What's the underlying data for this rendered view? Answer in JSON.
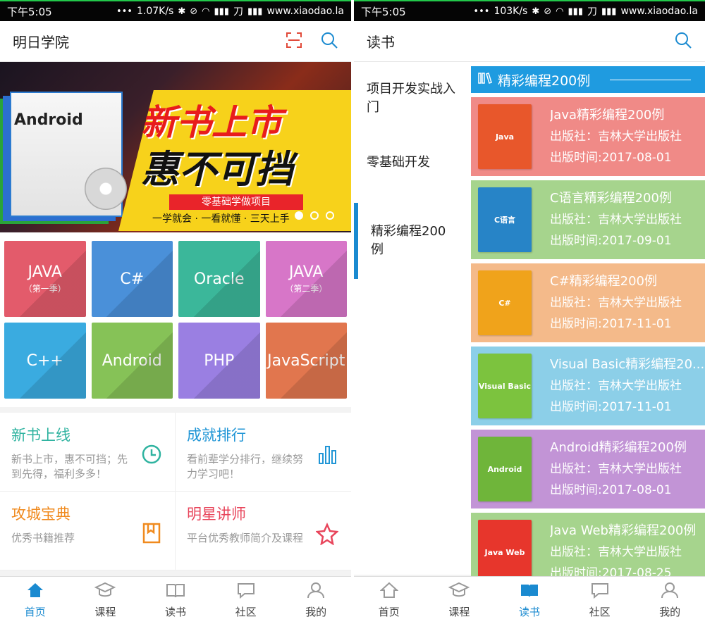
{
  "status_left": {
    "time": "下午5:05",
    "speed": "1.07K/s",
    "carrier": "刀",
    "site": "www.xiaodao.la"
  },
  "status_right": {
    "time": "下午5:05",
    "speed": "103K/s",
    "carrier": "刀",
    "site": "www.xiaodao.la"
  },
  "home": {
    "title": "明日学院",
    "banner": {
      "headline1": "新书上市",
      "headline2": "惠不可挡",
      "pill": "零基础学做项目",
      "slogan": "一学就会 · 一看就懂 · 三天上手",
      "book_label": "Android"
    },
    "courses": [
      {
        "name": "JAVA",
        "sub": "（第一季）",
        "color": "#e35b6b"
      },
      {
        "name": "C#",
        "sub": "",
        "color": "#4a90d9"
      },
      {
        "name": "Oracle",
        "sub": "",
        "color": "#3bb79a"
      },
      {
        "name": "JAVA",
        "sub": "（第二季）",
        "color": "#d776c8"
      },
      {
        "name": "C++",
        "sub": "",
        "color": "#3aabe0"
      },
      {
        "name": "Android",
        "sub": "",
        "color": "#86c257"
      },
      {
        "name": "PHP",
        "sub": "",
        "color": "#9a7fe2"
      },
      {
        "name": "JavaScript",
        "sub": "",
        "color": "#e1764e"
      }
    ],
    "features": [
      {
        "title": "新书上线",
        "desc": "新书上市，惠不可挡；先到先得，福利多多！",
        "color": "#2fb3a0",
        "icon": "clock-icon"
      },
      {
        "title": "成就排行",
        "desc": "看前辈学分排行，继续努力学习吧！",
        "color": "#2196d6",
        "icon": "bar-chart-icon"
      },
      {
        "title": "攻城宝典",
        "desc": "优秀书籍推荐",
        "color": "#f08a1e",
        "icon": "bookmark-icon"
      },
      {
        "title": "明星讲师",
        "desc": "平台优秀教师简介及课程",
        "color": "#e8455b",
        "icon": "star-icon"
      }
    ]
  },
  "read": {
    "title": "读书",
    "menu": [
      {
        "label": "项目开发实战入门",
        "active": false
      },
      {
        "label": "零基础开发",
        "active": false
      },
      {
        "label": "精彩编程200例",
        "active": true
      }
    ],
    "section_title": "精彩编程200例",
    "books": [
      {
        "title": "Java精彩编程200例",
        "publisher": "出版社：吉林大学出版社",
        "date": "出版时间:2017-08-01",
        "bg": "#f08a87",
        "cover": "#e8572b",
        "cover_text": "Java"
      },
      {
        "title": "C语言精彩编程200例",
        "publisher": "出版社：吉林大学出版社",
        "date": "出版时间:2017-09-01",
        "bg": "#a6d48d",
        "cover": "#2784c7",
        "cover_text": "C语言"
      },
      {
        "title": "C#精彩编程200例",
        "publisher": "出版社：吉林大学出版社",
        "date": "出版时间:2017-11-01",
        "bg": "#f4ba8a",
        "cover": "#f0a31b",
        "cover_text": "C#"
      },
      {
        "title": "Visual Basic精彩编程20...",
        "publisher": "出版社：吉林大学出版社",
        "date": "出版时间:2017-11-01",
        "bg": "#8ccfe8",
        "cover": "#7cc33e",
        "cover_text": "Visual Basic"
      },
      {
        "title": "Android精彩编程200例",
        "publisher": "出版社：吉林大学出版社",
        "date": "出版时间:2017-08-01",
        "bg": "#c294d6",
        "cover": "#6fb53a",
        "cover_text": "Android"
      },
      {
        "title": "Java Web精彩编程200例",
        "publisher": "出版社：吉林大学出版社",
        "date": "出版时间:2017-08-25",
        "bg": "#a6d48d",
        "cover": "#e7362c",
        "cover_text": "Java Web"
      }
    ]
  },
  "nav": {
    "home": "首页",
    "course": "课程",
    "read": "读书",
    "community": "社区",
    "mine": "我的"
  }
}
